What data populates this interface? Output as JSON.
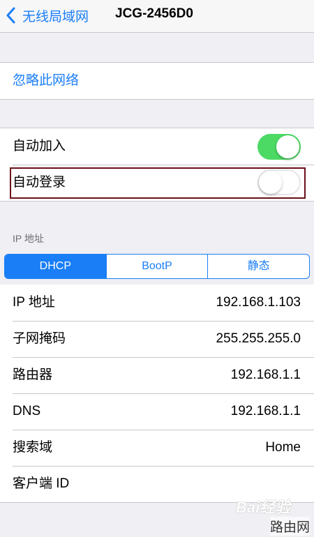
{
  "nav": {
    "back_label": "无线局域网",
    "title": "JCG-2456D0"
  },
  "forget": {
    "label": "忽略此网络"
  },
  "toggles": {
    "auto_join": {
      "label": "自动加入",
      "on": true
    },
    "auto_login": {
      "label": "自动登录",
      "on": false
    }
  },
  "ip_section": {
    "header": "IP 地址",
    "segments": [
      "DHCP",
      "BootP",
      "静态"
    ],
    "selected": "DHCP"
  },
  "details": [
    {
      "label": "IP 地址",
      "value": "192.168.1.103"
    },
    {
      "label": "子网掩码",
      "value": "255.255.255.0"
    },
    {
      "label": "路由器",
      "value": "192.168.1.1"
    },
    {
      "label": "DNS",
      "value": "192.168.1.1"
    },
    {
      "label": "搜索域",
      "value": "Home"
    },
    {
      "label": "客户端 ID",
      "value": ""
    }
  ],
  "watermark": {
    "logo": "Bai经验",
    "text": "路由网"
  },
  "colors": {
    "accent": "#1a7ef6",
    "switch_on": "#4cd964",
    "highlight_border": "#6b0f1a",
    "background": "#efeff4"
  }
}
